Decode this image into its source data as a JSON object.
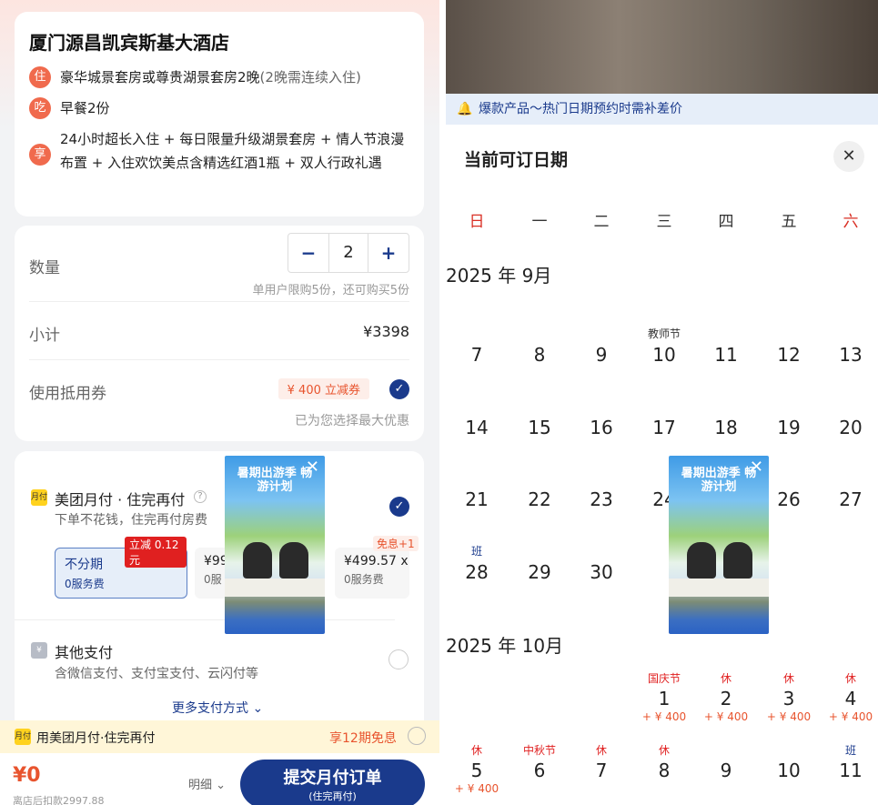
{
  "hotel": {
    "name": "厦门源昌凯宾斯基大酒店",
    "items": [
      {
        "badge": "住",
        "text": "豪华城景套房或尊贵湖景套房2晚",
        "note": "(2晚需连续入住)"
      },
      {
        "badge": "吃",
        "text": "早餐2份",
        "note": ""
      },
      {
        "badge": "享",
        "text": "24小时超长入住 + 每日限量升级湖景套房 + 情人节浪漫布置 + 入住欢饮美点含精选红酒1瓶 + 双人行政礼遇",
        "note": ""
      }
    ]
  },
  "order": {
    "qty_label": "数量",
    "qty_minus": "−",
    "qty_value": "2",
    "qty_plus": "+",
    "qty_limit": "单用户限购5份，还可购买5份",
    "subtotal_label": "小计",
    "subtotal_value": "¥3398",
    "coupon_label": "使用抵用券",
    "coupon_tag": "¥ 400 立减券",
    "coupon_note": "已为您选择最大优惠"
  },
  "payment": {
    "monthly_icon": "月付",
    "monthly_title": "美团月付 · 住完再付",
    "monthly_sub": "下单不花钱，住完再付房费",
    "plans": [
      {
        "badge": "立减 0.12 元",
        "title": "不分期",
        "sub": "0服务费"
      },
      {
        "badge": "",
        "title": "¥99",
        "sub": "0服"
      },
      {
        "badge": "免息+1",
        "title": "¥499.57 x",
        "sub": "0服务费"
      }
    ],
    "other_icon": "¥",
    "other_title": "其他支付",
    "other_sub": "含微信支付、支付宝支付、云闪付等",
    "more": "更多支付方式"
  },
  "promo_bar": {
    "icon": "月付",
    "text": "用美团月付·住完再付",
    "right": "享12期免息"
  },
  "bottom": {
    "price": "¥0",
    "after": "离店后扣款2997.88",
    "detail": "明细",
    "submit": "提交月付订单",
    "submit_sub": "(住完再付)"
  },
  "calendar": {
    "notice": "爆款产品～热门日期预约时需补差价",
    "title": "当前可订日期",
    "weekdays": [
      "日",
      "一",
      "二",
      "三",
      "四",
      "五",
      "六"
    ],
    "months": [
      {
        "label": "2025 年 9月"
      },
      {
        "label": "2025 年 10月"
      }
    ],
    "sep_days": [
      {
        "d": "7",
        "tag": "",
        "price": ""
      },
      {
        "d": "8",
        "tag": "",
        "price": ""
      },
      {
        "d": "9",
        "tag": "",
        "price": ""
      },
      {
        "d": "10",
        "tag": "教师节",
        "price": ""
      },
      {
        "d": "11",
        "tag": "",
        "price": ""
      },
      {
        "d": "12",
        "tag": "",
        "price": ""
      },
      {
        "d": "13",
        "tag": "",
        "price": ""
      },
      {
        "d": "14",
        "tag": "",
        "price": ""
      },
      {
        "d": "15",
        "tag": "",
        "price": ""
      },
      {
        "d": "16",
        "tag": "",
        "price": ""
      },
      {
        "d": "17",
        "tag": "",
        "price": ""
      },
      {
        "d": "18",
        "tag": "",
        "price": ""
      },
      {
        "d": "19",
        "tag": "",
        "price": ""
      },
      {
        "d": "20",
        "tag": "",
        "price": ""
      },
      {
        "d": "21",
        "tag": "",
        "price": ""
      },
      {
        "d": "22",
        "tag": "",
        "price": ""
      },
      {
        "d": "23",
        "tag": "",
        "price": ""
      },
      {
        "d": "24",
        "tag": "",
        "price": ""
      },
      {
        "d": "25",
        "tag": "",
        "price": ""
      },
      {
        "d": "26",
        "tag": "",
        "price": ""
      },
      {
        "d": "27",
        "tag": "",
        "price": ""
      },
      {
        "d": "28",
        "tag": "班",
        "price": ""
      },
      {
        "d": "29",
        "tag": "",
        "price": ""
      },
      {
        "d": "30",
        "tag": "",
        "price": ""
      }
    ],
    "oct_days": [
      {
        "d": "1",
        "tag": "国庆节",
        "price": "+ ¥ 400"
      },
      {
        "d": "2",
        "tag": "休",
        "price": "+ ¥ 400"
      },
      {
        "d": "3",
        "tag": "休",
        "price": "+ ¥ 400"
      },
      {
        "d": "4",
        "tag": "休",
        "price": "+ ¥ 400"
      },
      {
        "d": "5",
        "tag": "休",
        "price": "+ ¥ 400"
      },
      {
        "d": "6",
        "tag": "中秋节",
        "price": ""
      },
      {
        "d": "7",
        "tag": "休",
        "price": ""
      },
      {
        "d": "8",
        "tag": "休",
        "price": ""
      },
      {
        "d": "9",
        "tag": "",
        "price": ""
      },
      {
        "d": "10",
        "tag": "",
        "price": ""
      },
      {
        "d": "11",
        "tag": "班",
        "price": ""
      }
    ]
  },
  "ad": {
    "headline": "暑期出游季 畅游计划",
    "close": "✕"
  },
  "colors": {
    "brand": "#1a3a8c",
    "accent": "#e8542e",
    "badge": "#f06a4d",
    "promo_bg": "#fff6d8"
  }
}
